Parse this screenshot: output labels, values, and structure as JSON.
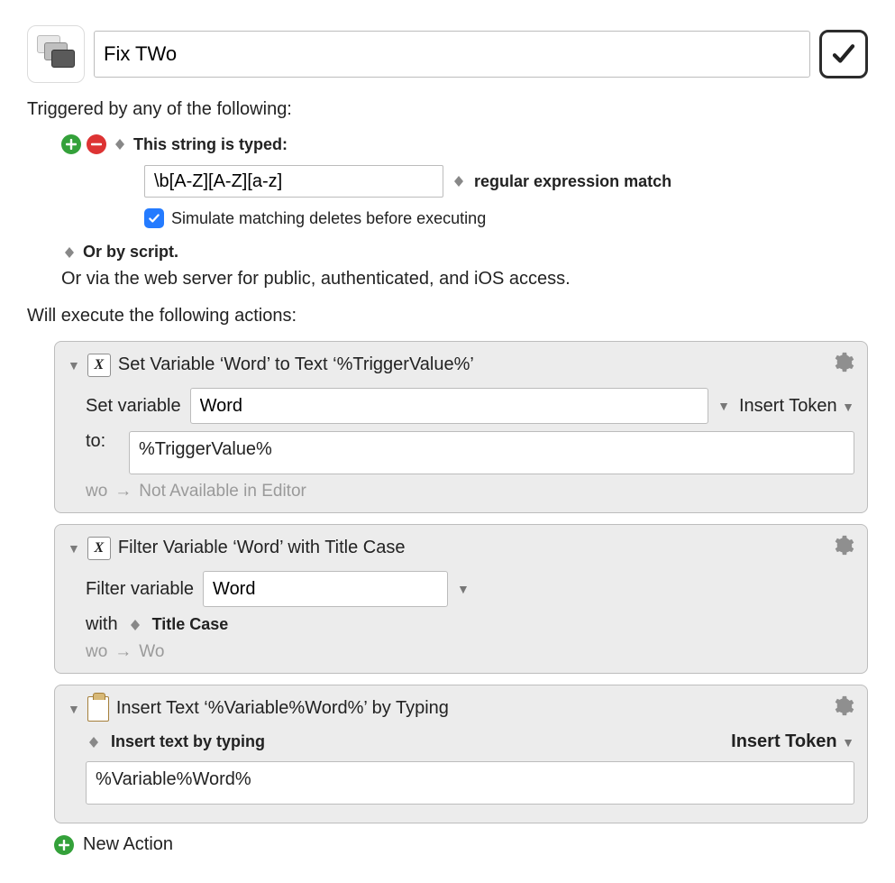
{
  "header": {
    "macro_name": "Fix TWo"
  },
  "triggers": {
    "title": "Triggered by any of the following:",
    "typed_label": "This string is typed:",
    "regex_value": "\\b[A-Z][A-Z][a-z]",
    "match_mode": "regular expression match",
    "simulate_label": "Simulate matching deletes before executing",
    "or_script": "Or by script.",
    "or_web": "Or via the web server for public, authenticated, and iOS access."
  },
  "actions_title": "Will execute the following actions:",
  "actions": [
    {
      "title": "Set Variable ‘Word’ to Text ‘%TriggerValue%’",
      "set_label": "Set variable",
      "var_name": "Word",
      "token_label": "Insert Token",
      "to_label": "to:",
      "to_value": "%TriggerValue%",
      "footer_left": "wo",
      "footer_right": "Not Available in Editor"
    },
    {
      "title": "Filter Variable ‘Word’ with Title Case",
      "filter_label": "Filter variable",
      "var_name": "Word",
      "with_label": "with",
      "filter_name": "Title Case",
      "footer_left": "wo",
      "footer_right": "Wo"
    },
    {
      "title": "Insert Text ‘%Variable%Word%’ by Typing",
      "mode_label": "Insert text by typing",
      "token_label": "Insert Token",
      "text_value": "%Variable%Word%"
    }
  ],
  "new_action_label": "New Action"
}
